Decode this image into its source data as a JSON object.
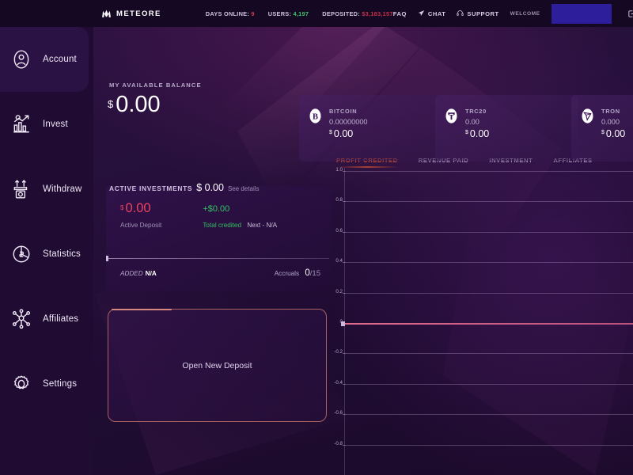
{
  "header": {
    "logo_text": "METEORE",
    "logo_icon": "meteore-m-logo-icon",
    "stats": [
      {
        "label": "DAYS ONLINE:",
        "value": "9",
        "value_color": "#d83a4e"
      },
      {
        "label": "USERS:",
        "value": "4,197",
        "value_color": "#3ec46a"
      },
      {
        "label": "DEPOSITED:",
        "value": "$3,183,157",
        "value_color": "#c33248"
      }
    ],
    "nav": [
      {
        "label": "FAQ",
        "icon": "none"
      },
      {
        "label": "CHAT",
        "icon": "paper-plane-icon"
      },
      {
        "label": "SUPPORT",
        "icon": "headset-icon"
      }
    ],
    "welcome_label": "WELCOME",
    "username_value": "",
    "logout_icon": "logout-icon"
  },
  "sidebar": {
    "items": [
      {
        "label": "Account",
        "icon": "user-circle-icon",
        "active": true
      },
      {
        "label": "Invest",
        "icon": "chart-growth-icon",
        "active": false
      },
      {
        "label": "Withdraw",
        "icon": "withdraw-arrows-icon",
        "active": false
      },
      {
        "label": "Statistics",
        "icon": "pie-dollar-icon",
        "active": false
      },
      {
        "label": "Affiliates",
        "icon": "network-users-icon",
        "active": false
      },
      {
        "label": "Settings",
        "icon": "gear-icon",
        "active": false
      }
    ]
  },
  "balance": {
    "label": "MY AVAILABLE BALANCE",
    "currency": "$",
    "amount": "0.00"
  },
  "coin_cards": [
    {
      "name": "BITCOIN",
      "icon": "bitcoin-icon",
      "qty": "0.00000000",
      "currency": "$",
      "usd": "0.00"
    },
    {
      "name": "TRC20",
      "icon": "tether-icon",
      "qty": "0.00",
      "currency": "$",
      "usd": "0.00"
    },
    {
      "name": "TRON",
      "icon": "tron-icon",
      "qty": "0.000",
      "currency": "$",
      "usd": "0.00"
    }
  ],
  "active_investments": {
    "label": "ACTIVE INVESTMENTS",
    "amount": "$ 0.00",
    "details_link": "See details"
  },
  "deposit_card": {
    "currency": "$",
    "amount": "0.00",
    "amount_sub": "Active Deposit",
    "credited": "+$0.00",
    "credited_sub": "Total credited",
    "next_label": "Next - N/A",
    "added_label": "ADDED",
    "added_value": "N/A",
    "accruals_label": "Accruals",
    "accruals_current": "0",
    "accruals_total": "/15"
  },
  "open_deposit": {
    "label": "Open New Deposit"
  },
  "chart_data": {
    "type": "line",
    "title": "",
    "tabs": [
      {
        "label": "PROFIT CREDITED",
        "active": true
      },
      {
        "label": "REVENUE PAID",
        "active": false
      },
      {
        "label": "INVESTMENT",
        "active": false
      },
      {
        "label": "AFFILIATES",
        "active": false
      }
    ],
    "active_tab": "PROFIT CREDITED",
    "xlabel": "",
    "ylabel": "",
    "ylim": [
      -1.0,
      1.0
    ],
    "yticks": [
      "1.0",
      "0.8",
      "0.6",
      "0.4",
      "0.2",
      "0",
      "-0.2",
      "-0.4",
      "-0.6",
      "-0.8"
    ],
    "grid": true,
    "legend": "none",
    "series": [
      {
        "name": "Profit credited",
        "color": "#d4608a",
        "values": [
          0,
          0,
          0,
          0,
          0,
          0,
          0,
          0,
          0,
          0
        ]
      }
    ],
    "x": [],
    "xticklabels": []
  },
  "colors": {
    "background": "#1d0b2e",
    "sidebar": "#200b33",
    "topbar": "#150822",
    "accent_orange": "#e4592f",
    "accent_green": "#34c15f",
    "accent_red": "#ef4060",
    "accent_blue_chip": "#2d1e9c",
    "chart_line": "#d4608a"
  }
}
